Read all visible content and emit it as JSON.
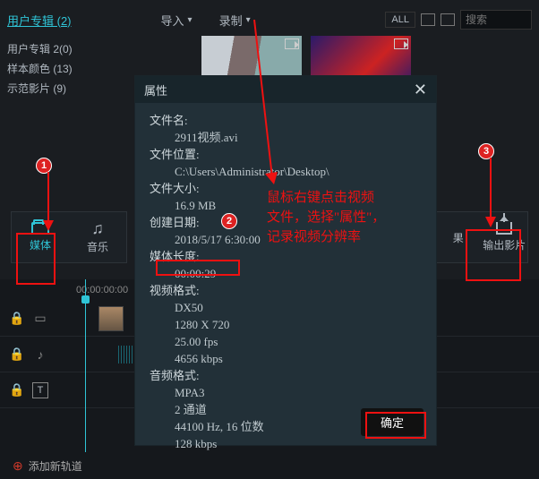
{
  "topbar": {
    "breadcrumb": "用户专辑 (2)",
    "import": "导入",
    "record": "录制",
    "all": "ALL",
    "search_placeholder": "搜索"
  },
  "sidebar": {
    "items": [
      "用户专辑 2(0)",
      "样本颜色 (13)",
      "示范影片 (9)"
    ]
  },
  "tabs_left": {
    "media": "媒体",
    "music": "音乐"
  },
  "tabs_right": {
    "effect": "果",
    "export": "输出影片"
  },
  "dialog": {
    "title": "属性",
    "rows": [
      {
        "k": "文件名:",
        "v": "2911视频.avi"
      },
      {
        "k": "文件位置:",
        "v": "C:\\Users\\Administrator\\Desktop\\"
      },
      {
        "k": "文件大小:",
        "v": "16.9 MB"
      },
      {
        "k": "创建日期:",
        "v": "2018/5/17 6:30:00"
      },
      {
        "k": "媒体长度:",
        "v": "00:00:29"
      },
      {
        "k": "视频格式:",
        "v": ""
      }
    ],
    "video_lines": [
      "DX50",
      "1280 X 720",
      "25.00  fps",
      "4656  kbps"
    ],
    "audio_label": "音频格式:",
    "audio_lines": [
      "MPA3",
      "2 通道",
      "44100  Hz, 16 位数",
      "128  kbps"
    ],
    "ok": "确定"
  },
  "timeline": {
    "time_a": "00:00:00:00",
    "time_b": "00:00:00:00"
  },
  "footer": {
    "add_track": "添加新轨道"
  },
  "annotation": {
    "text": "鼠标右键点击视频\n文件，选择\"属性\"，\n记录视频分辨率"
  }
}
